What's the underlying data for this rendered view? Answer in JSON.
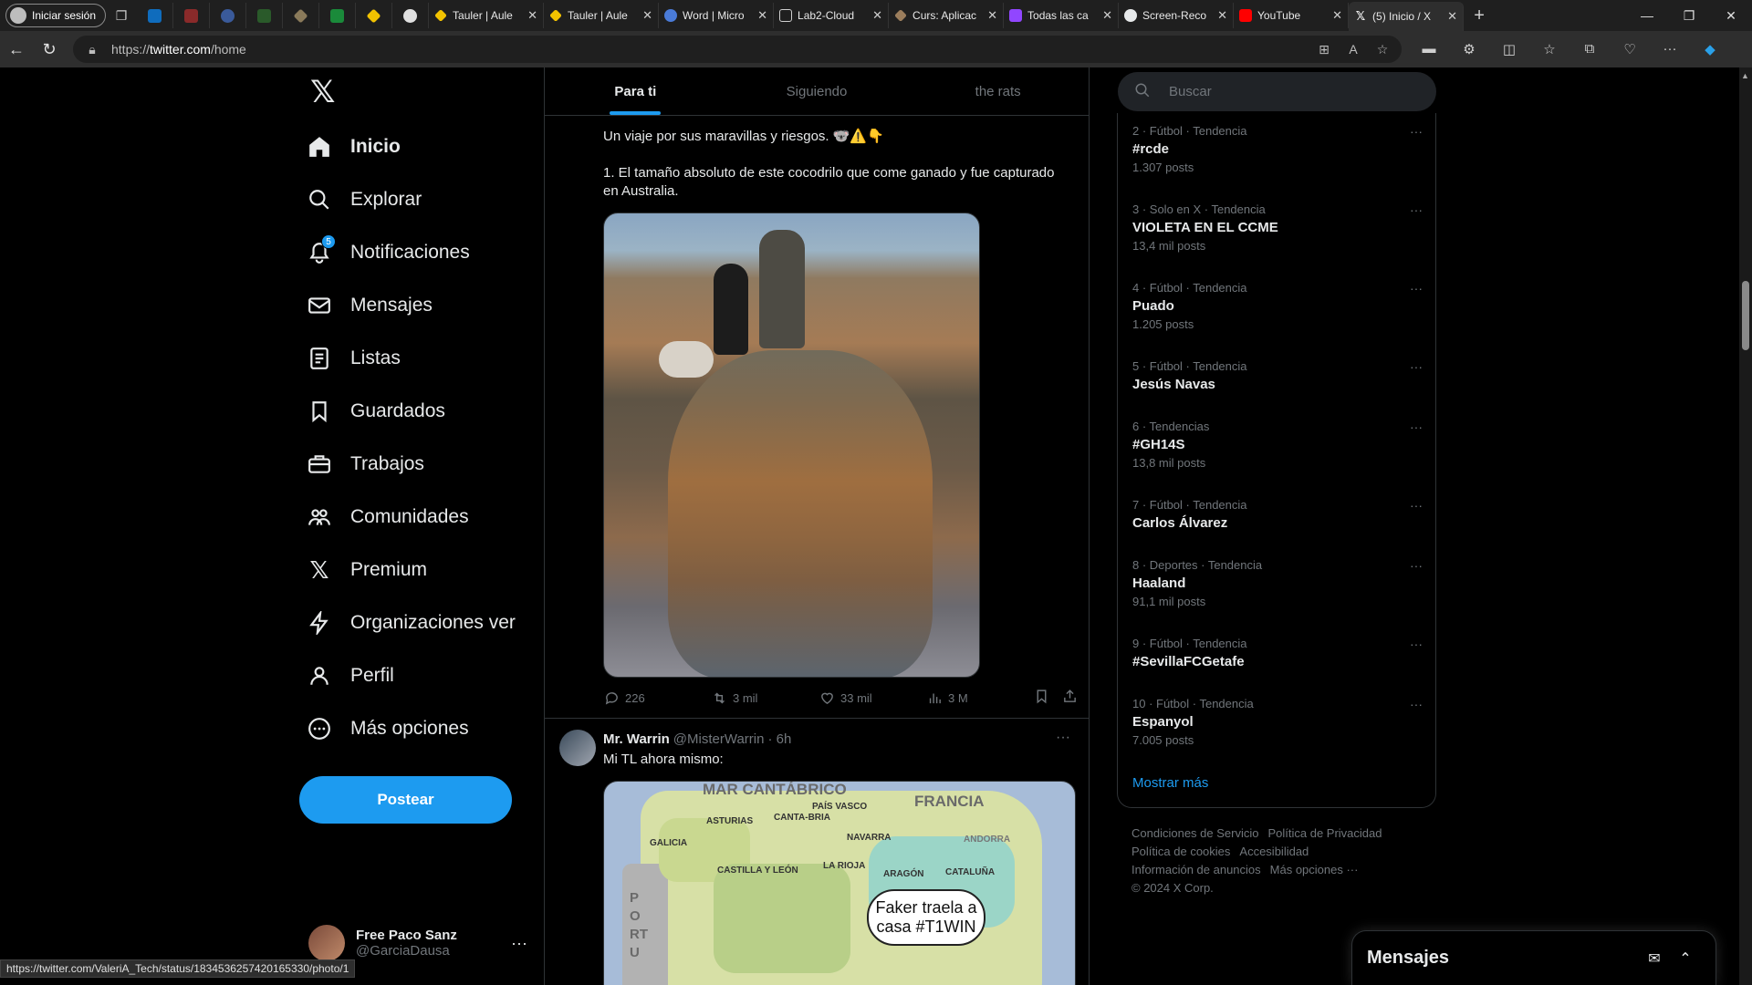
{
  "browser": {
    "profile_label": "Iniciar sesión",
    "tabs": [
      {
        "title": "Tauler | Aule",
        "color": "#f2c200"
      },
      {
        "title": "Tauler | Aule",
        "color": "#f2c200"
      },
      {
        "title": "Word | Micro",
        "color": "#4a7bd8"
      },
      {
        "title": "Lab2-Cloud",
        "color": "#cfcfcf"
      },
      {
        "title": "Curs: Aplicac",
        "color": "#9b7d5c"
      },
      {
        "title": "Todas las ca",
        "color": "#9146ff"
      },
      {
        "title": "Screen-Reco",
        "color": "#e7e9ea"
      },
      {
        "title": "YouTube",
        "color": "#ff0000"
      },
      {
        "title": "(5) Inicio / X",
        "color": "#e7e9ea"
      }
    ],
    "url_prefix": "https://",
    "url_host": "twitter.com",
    "url_path": "/home",
    "status_url": "https://twitter.com/ValeriA_Tech/status/1834536257420165330/photo/1"
  },
  "nav": {
    "items": [
      {
        "label": "Inicio",
        "icon": "home-icon"
      },
      {
        "label": "Explorar",
        "icon": "search-icon"
      },
      {
        "label": "Notificaciones",
        "icon": "bell-icon",
        "badge": "5"
      },
      {
        "label": "Mensajes",
        "icon": "mail-icon"
      },
      {
        "label": "Listas",
        "icon": "list-icon"
      },
      {
        "label": "Guardados",
        "icon": "bookmark-icon"
      },
      {
        "label": "Trabajos",
        "icon": "briefcase-icon"
      },
      {
        "label": "Comunidades",
        "icon": "people-icon"
      },
      {
        "label": "Premium",
        "icon": "x-icon"
      },
      {
        "label": "Organizaciones ver",
        "icon": "lightning-icon"
      },
      {
        "label": "Perfil",
        "icon": "person-icon"
      },
      {
        "label": "Más opciones",
        "icon": "more-circle-icon"
      }
    ],
    "post_button": "Postear",
    "account_name": "Free Paco Sanz",
    "account_handle": "@GarciaDausa"
  },
  "timeline": {
    "tabs": [
      "Para ti",
      "Siguiendo",
      "the rats"
    ],
    "tweet1": {
      "line1": "Un viaje por sus maravillas y riesgos. 🐨⚠️👇",
      "line2": "1. El tamaño absoluto de este cocodrilo que come ganado y fue capturado",
      "line3": "en Australia.",
      "replies": "226",
      "retweets": "3 mil",
      "likes": "33 mil",
      "views": "3 M"
    },
    "tweet2": {
      "name": "Mr. Warrin",
      "handle": "@MisterWarrin",
      "time": "· 6h",
      "text": "Mi TL ahora mismo:",
      "map": {
        "sea": "MAR CANTÁBRICO",
        "france": "FRANCIA",
        "regions": [
          "GALICIA",
          "ASTURIAS",
          "CANTA-BRIA",
          "PAÍS VASCO",
          "NAVARRA",
          "CASTILLA Y LEÓN",
          "LA RIOJA",
          "ARAGÓN",
          "CATALUÑA",
          "ANDORRA"
        ],
        "bubble": "Faker traela a casa #T1WIN",
        "portugal": "PORTU"
      }
    }
  },
  "right": {
    "search_placeholder": "Buscar",
    "trends": [
      {
        "meta": "2 · Fútbol · Tendencia",
        "name": "#rcde",
        "count": "1.307 posts"
      },
      {
        "meta": "3 · Solo en X · Tendencia",
        "name": "VIOLETA EN EL CCME",
        "count": "13,4 mil posts"
      },
      {
        "meta": "4 · Fútbol · Tendencia",
        "name": "Puado",
        "count": "1.205 posts"
      },
      {
        "meta": "5 · Fútbol · Tendencia",
        "name": "Jesús Navas",
        "count": ""
      },
      {
        "meta": "6 · Tendencias",
        "name": "#GH14S",
        "count": "13,8 mil posts"
      },
      {
        "meta": "7 · Fútbol · Tendencia",
        "name": "Carlos Álvarez",
        "count": ""
      },
      {
        "meta": "8 · Deportes · Tendencia",
        "name": "Haaland",
        "count": "91,1 mil posts"
      },
      {
        "meta": "9 · Fútbol · Tendencia",
        "name": "#SevillaFCGetafe",
        "count": ""
      },
      {
        "meta": "10 · Fútbol · Tendencia",
        "name": "Espanyol",
        "count": "7.005 posts"
      }
    ],
    "show_more": "Mostrar más",
    "footer": {
      "terms": "Condiciones de Servicio",
      "privacy": "Política de Privacidad",
      "cookies": "Política de cookies",
      "accessibility": "Accesibilidad",
      "ads": "Información de anuncios",
      "more": "Más opciones ···",
      "copyright": "© 2024 X Corp."
    }
  },
  "messages_drawer": {
    "title": "Mensajes"
  }
}
